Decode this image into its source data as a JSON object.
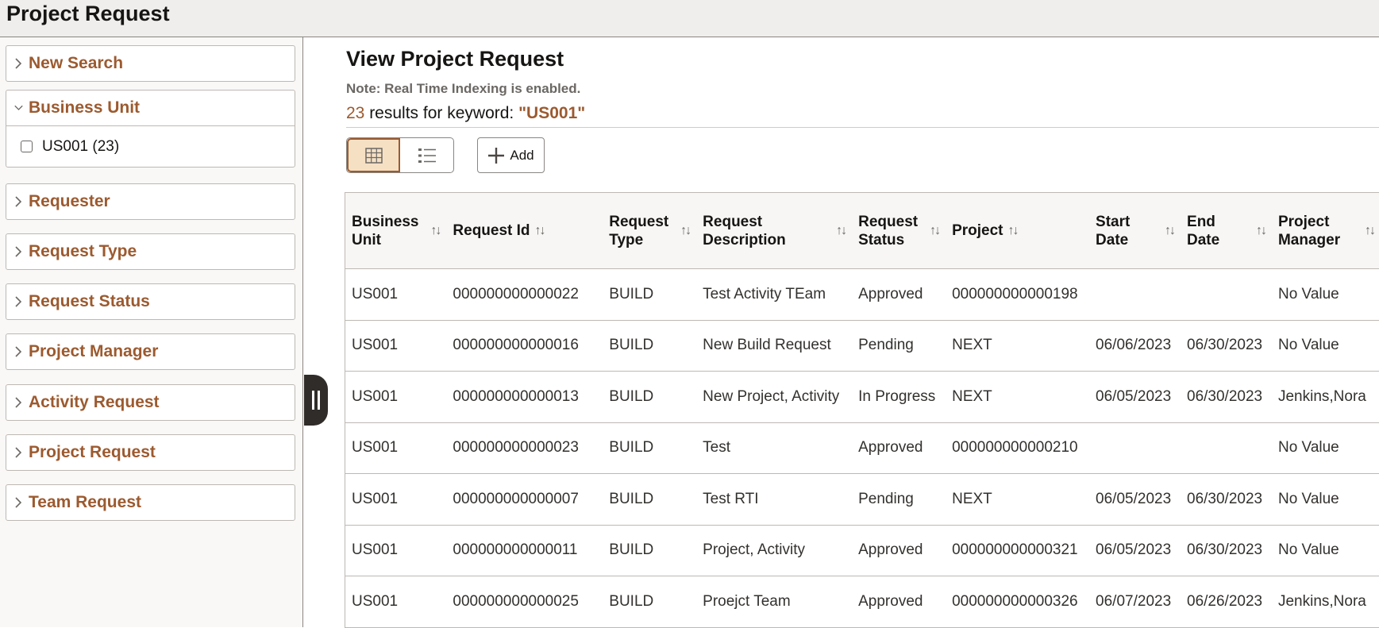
{
  "header": {
    "title": "Project Request"
  },
  "sidebar": {
    "facets": [
      {
        "label": "New Search",
        "expanded": false
      },
      {
        "label": "Business Unit",
        "expanded": true,
        "options": [
          {
            "label": "US001 (23)",
            "checked": false
          }
        ]
      },
      {
        "label": "Requester",
        "expanded": false
      },
      {
        "label": "Request Type",
        "expanded": false
      },
      {
        "label": "Request Status",
        "expanded": false
      },
      {
        "label": "Project Manager",
        "expanded": false
      },
      {
        "label": "Activity Request",
        "expanded": false
      },
      {
        "label": "Project Request",
        "expanded": false
      },
      {
        "label": "Team Request",
        "expanded": false
      }
    ],
    "collapse_handle_icon": "pause-bars-icon"
  },
  "main": {
    "title": "View Project Request",
    "note": "Note: Real Time Indexing is enabled.",
    "results": {
      "count": "23",
      "text": " results for keyword: ",
      "keyword": "\"US001\""
    },
    "view_toggle": {
      "grid_icon": "grid-view-icon",
      "list_icon": "list-view-icon",
      "active": "grid"
    },
    "add_button": {
      "label": "Add",
      "icon": "plus-icon"
    },
    "table": {
      "columns": [
        "Business Unit",
        "Request Id",
        "Request Type",
        "Request Description",
        "Request Status",
        "Project",
        "Start Date",
        "End Date",
        "Project Manager"
      ],
      "rows": [
        [
          "US001",
          "000000000000022",
          "BUILD",
          "Test Activity TEam",
          "Approved",
          "000000000000198",
          "",
          "",
          "No Value"
        ],
        [
          "US001",
          "000000000000016",
          "BUILD",
          "New Build Request",
          "Pending",
          "NEXT",
          "06/06/2023",
          "06/30/2023",
          "No Value"
        ],
        [
          "US001",
          "000000000000013",
          "BUILD",
          "New Project, Activity",
          "In Progress",
          "NEXT",
          "06/05/2023",
          "06/30/2023",
          "Jenkins,Nora"
        ],
        [
          "US001",
          "000000000000023",
          "BUILD",
          "Test",
          "Approved",
          "000000000000210",
          "",
          "",
          "No Value"
        ],
        [
          "US001",
          "000000000000007",
          "BUILD",
          "Test RTI",
          "Pending",
          "NEXT",
          "06/05/2023",
          "06/30/2023",
          "No Value"
        ],
        [
          "US001",
          "000000000000011",
          "BUILD",
          "Project, Activity",
          "Approved",
          "000000000000321",
          "06/05/2023",
          "06/30/2023",
          "No Value"
        ],
        [
          "US001",
          "000000000000025",
          "BUILD",
          "Proejct Team",
          "Approved",
          "000000000000326",
          "06/07/2023",
          "06/26/2023",
          "Jenkins,Nora"
        ]
      ]
    }
  },
  "colors": {
    "accent": "#9c5a2f",
    "active_toggle_bg": "#f6e0c4",
    "header_bg": "#efeeed",
    "sidebar_bg": "#f9f8f7"
  }
}
